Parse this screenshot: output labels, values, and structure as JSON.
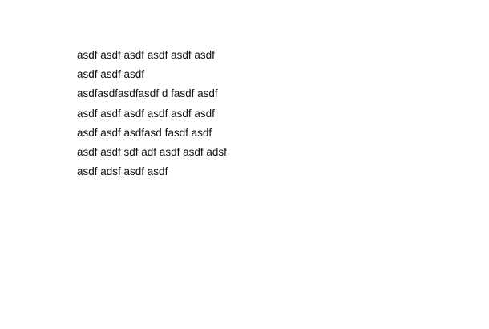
{
  "lines": [
    "asdf asdf asdf asdf asdf asdf",
    "asdf asdf asdf",
    "asdfasdfasdfasdf d fasdf asdf",
    "asdf asdf asdf asdf asdf asdf",
    "asdf asdf asdfasd fasdf asdf",
    "asdf asdf sdf adf asdf asdf adsf",
    "asdf adsf asdf asdf"
  ]
}
